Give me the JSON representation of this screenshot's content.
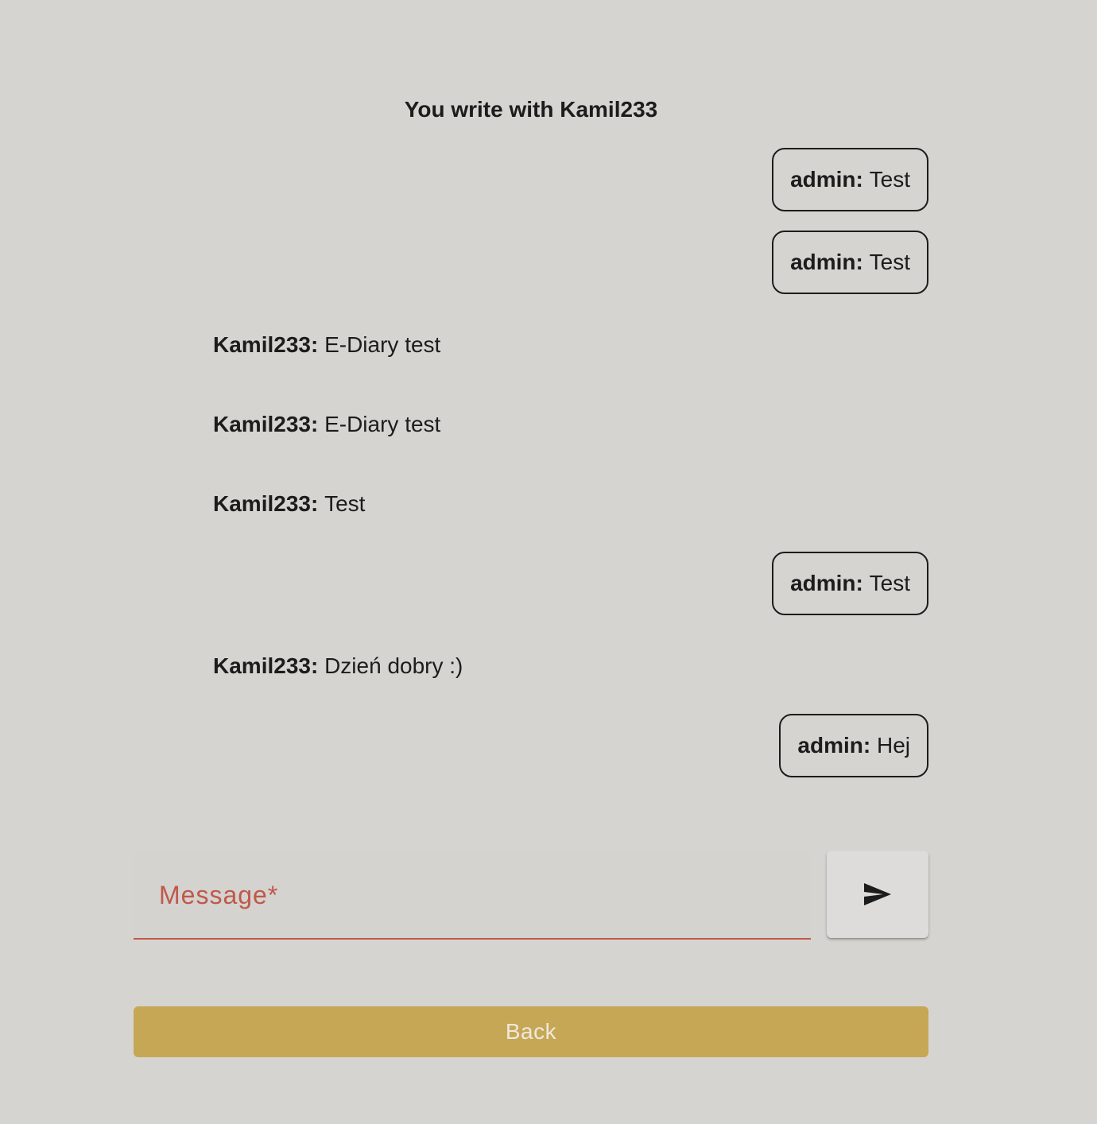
{
  "chat": {
    "title": "You write with Kamil233"
  },
  "messages": [
    {
      "author": "admin:",
      "text": "Test",
      "side": "mine"
    },
    {
      "author": "admin:",
      "text": "Test",
      "side": "mine"
    },
    {
      "author": "Kamil233:",
      "text": "E-Diary test",
      "side": "theirs"
    },
    {
      "author": "Kamil233:",
      "text": "E-Diary test",
      "side": "theirs"
    },
    {
      "author": "Kamil233:",
      "text": "Test",
      "side": "theirs"
    },
    {
      "author": "admin:",
      "text": "Test",
      "side": "mine"
    },
    {
      "author": "Kamil233:",
      "text": "Dzień dobry :)",
      "side": "theirs"
    },
    {
      "author": "admin:",
      "text": "Hej",
      "side": "mine"
    }
  ],
  "composer": {
    "placeholder": "Message*",
    "value": "",
    "send_icon": "send-icon",
    "accent_color": "#c0584a"
  },
  "actions": {
    "back_label": "Back",
    "back_color": "#c6a756"
  }
}
